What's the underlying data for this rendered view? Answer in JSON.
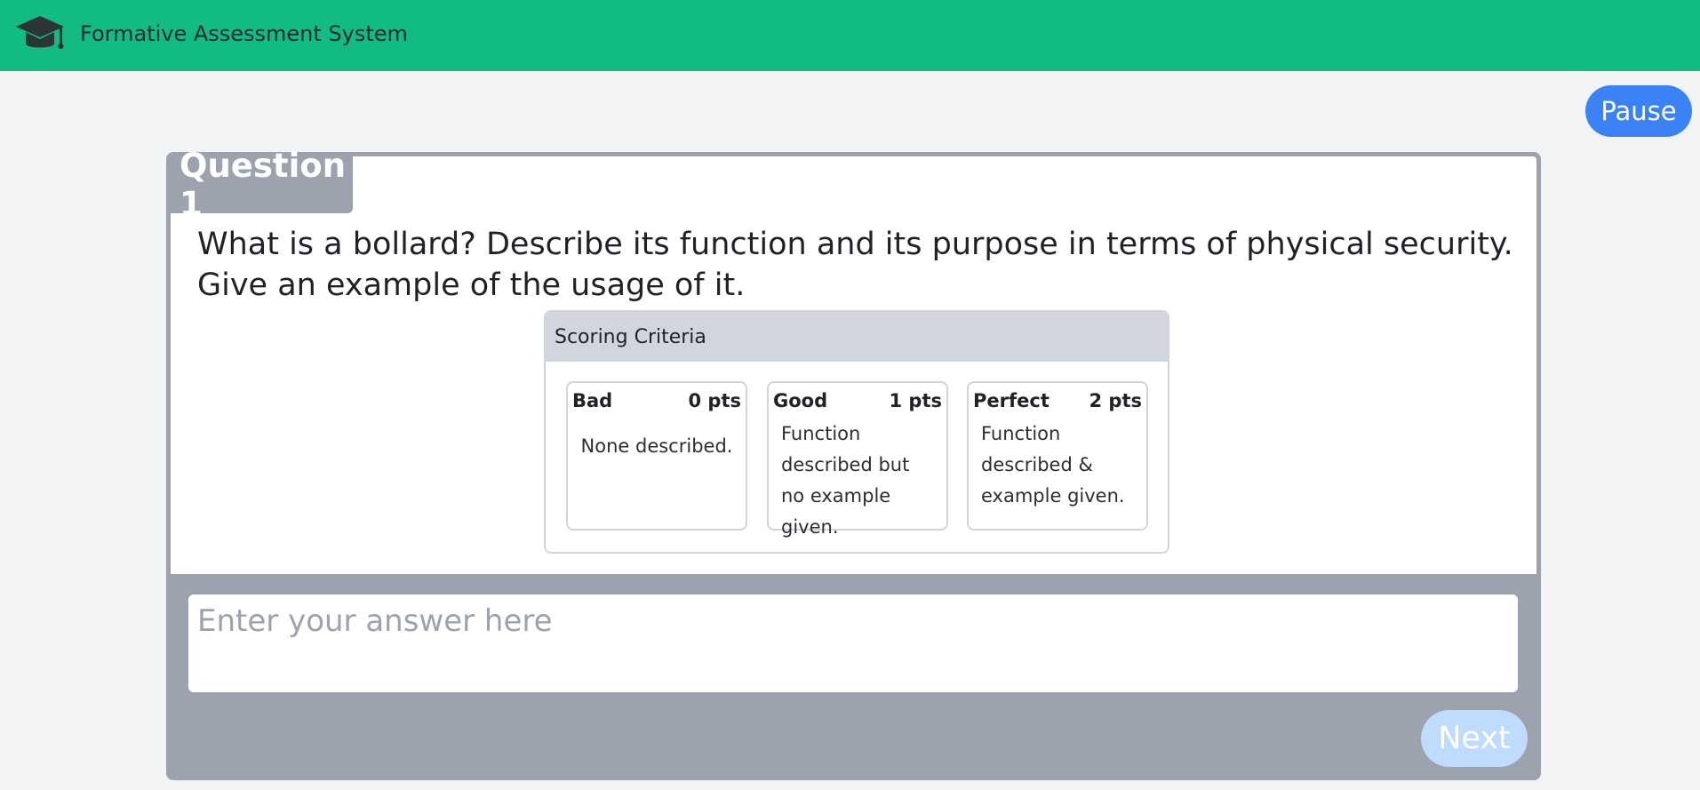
{
  "header": {
    "app_title": "Formative Assessment System",
    "logo_icon": "graduation-cap-icon",
    "background_color": "#12bb82"
  },
  "controls": {
    "pause_label": "Pause",
    "next_label": "Next"
  },
  "question": {
    "label": "Question 1",
    "text": "What is a bollard? Describe its function and its purpose in terms of physical security. Give an example of the usage of it."
  },
  "scoring": {
    "title": "Scoring Criteria",
    "levels": [
      {
        "name": "Bad",
        "points": "0 pts",
        "description": "None described."
      },
      {
        "name": "Good",
        "points": "1 pts",
        "description": "Function described but no example given."
      },
      {
        "name": "Perfect",
        "points": "2 pts",
        "description": "Function described & example given."
      }
    ]
  },
  "answer": {
    "placeholder": "Enter your answer here",
    "value": ""
  }
}
